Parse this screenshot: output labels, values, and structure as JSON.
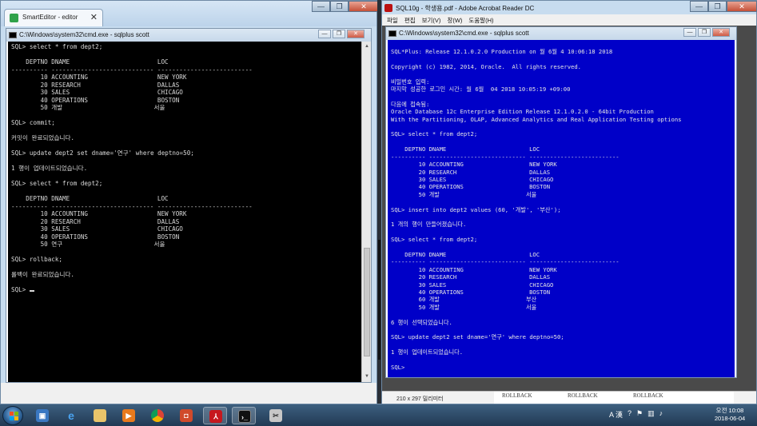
{
  "left_window": {
    "browser_tab": {
      "title": "SmartEditor - editor",
      "close": "✕"
    },
    "window_controls": [
      "—",
      "❐",
      "✕"
    ],
    "cmd_title": "C:\\Windows\\system32\\cmd.exe - sqlplus  scott",
    "cmd_controls": [
      "—",
      "❐",
      "✕"
    ],
    "console_lines": [
      "SQL> select * from dept2;",
      "",
      "    DEPTNO DNAME                        LOC",
      "---------- ---------------------------- --------------------------",
      "        10 ACCOUNTING                   NEW YORK",
      "        20 RESEARCH                     DALLAS",
      "        30 SALES                        CHICAGO",
      "        40 OPERATIONS                   BOSTON",
      "        50 개발                         서울",
      "",
      "SQL> commit;",
      "",
      "커밋이 완료되었습니다.",
      "",
      "SQL> update dept2 set dname='연구' where deptno=50;",
      "",
      "1 행이 업데이트되었습니다.",
      "",
      "SQL> select * from dept2;",
      "",
      "    DEPTNO DNAME                        LOC",
      "---------- ---------------------------- --------------------------",
      "        10 ACCOUNTING                   NEW YORK",
      "        20 RESEARCH                     DALLAS",
      "        30 SALES                        CHICAGO",
      "        40 OPERATIONS                   BOSTON",
      "        50 연구                         서울",
      "",
      "SQL> rollback;",
      "",
      "롤백이 완료되었습니다.",
      "",
      "SQL> "
    ]
  },
  "right_window": {
    "title": "SQL10g - 학생용.pdf - Adobe Acrobat Reader DC",
    "window_controls": [
      "—",
      "❐",
      "✕"
    ],
    "menu": [
      "파일",
      "편집",
      "보기(V)",
      "창(W)",
      "도움말(H)"
    ],
    "cmd_title": "C:\\Windows\\system32\\cmd.exe - sqlplus  scott",
    "cmd_controls": [
      "—",
      "❐",
      "✕"
    ],
    "console_lines": [
      "SQL*Plus: Release 12.1.0.2.0 Production on 월 6월 4 10:06:18 2018",
      "",
      "Copyright (c) 1982, 2014, Oracle.  All rights reserved.",
      "",
      "비밀번호 입력:",
      "마지막 성공한 로그인 시간: 월 6월  04 2018 10:05:19 +09:00",
      "",
      "다음에 접속됨:",
      "Oracle Database 12c Enterprise Edition Release 12.1.0.2.0 - 64bit Production",
      "With the Partitioning, OLAP, Advanced Analytics and Real Application Testing options",
      "",
      "SQL> select * from dept2;",
      "",
      "    DEPTNO DNAME                        LOC",
      "---------- ---------------------------- --------------------------",
      "        10 ACCOUNTING                   NEW YORK",
      "        20 RESEARCH                     DALLAS",
      "        30 SALES                        CHICAGO",
      "        40 OPERATIONS                   BOSTON",
      "        50 개발                         서울",
      "",
      "SQL> insert into dept2 values (60, '개발', '부산');",
      "",
      "1 개의 행이 만들어졌습니다.",
      "",
      "SQL> select * from dept2;",
      "",
      "    DEPTNO DNAME                        LOC",
      "---------- ---------------------------- --------------------------",
      "        10 ACCOUNTING                   NEW YORK",
      "        20 RESEARCH                     DALLAS",
      "        30 SALES                        CHICAGO",
      "        40 OPERATIONS                   BOSTON",
      "        60 개발                         부산",
      "        50 개발                         서울",
      "",
      "6 행이 선택되었습니다.",
      "",
      "SQL> update dept2 set dname='연구' where deptno=50;",
      "",
      "1 행이 업데이트되었습니다.",
      "",
      "SQL>"
    ],
    "page_size": "210 x 297 밀리미터",
    "pdf_strip": [
      "ROLLBACK",
      "ROLLBACK",
      "ROLLBACK"
    ]
  },
  "taskbar": {
    "tray": {
      "lang": "A 漢",
      "help": "?",
      "volume": "♪"
    },
    "clock": {
      "time": "오전 10:08",
      "date": "2018-06-04"
    }
  },
  "colors": {
    "blue_console": "#0000c8",
    "black_console": "#000000"
  }
}
